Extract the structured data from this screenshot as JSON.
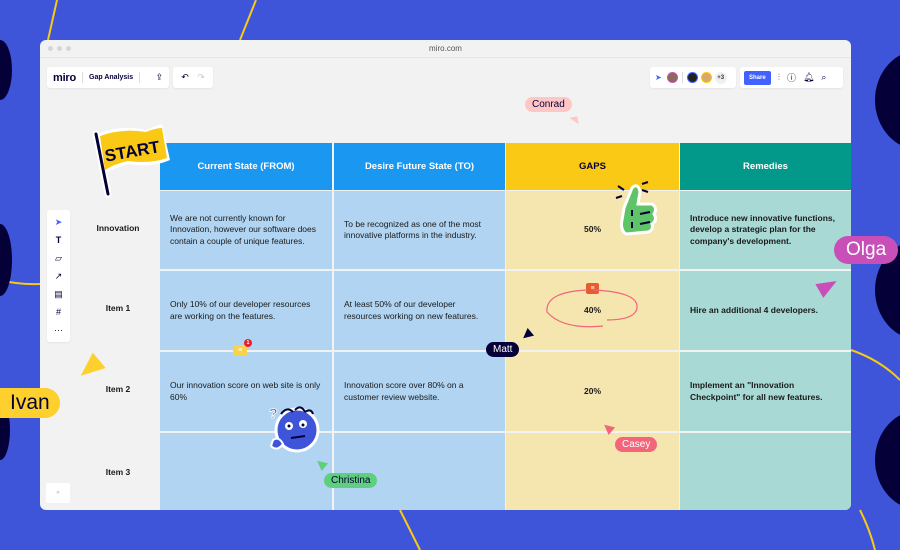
{
  "browser": {
    "url": "miro.com"
  },
  "header": {
    "logo": "miro",
    "board_name": "Gap Analysis",
    "upload_icon": "upload-icon",
    "undo_icon": "undo-icon",
    "redo_icon": "redo-icon",
    "collaborators_extra": "+3",
    "share_label": "Share",
    "icons": [
      "settings-sliders-icon",
      "help-icon",
      "bell-icon",
      "search-icon"
    ]
  },
  "toolbar": {
    "tools": [
      "select-icon",
      "text-icon",
      "sticky-note-icon",
      "line-arrow-icon",
      "comment-icon",
      "frame-icon",
      "more-icon"
    ],
    "expand_label": "»"
  },
  "colors": {
    "background": "#3e54d9",
    "from_header": "#1a97f0",
    "to_header": "#1a97f0",
    "gaps_header": "#f9c915",
    "remedies_header": "#02998a",
    "from_cell": "#b0d4f1",
    "gaps_cell": "#f5e6b0",
    "remedies_cell": "#a9d9d4"
  },
  "table": {
    "headers": [
      "Current State (FROM)",
      "Desire Future State (TO)",
      "GAPS",
      "Remedies"
    ],
    "rows": [
      {
        "label": "Innovation",
        "from": "We are not currently known for Innovation, however our software does contain a couple of unique features.",
        "to": "To be recognized as one of the most innovative platforms in the industry.",
        "gap": "50%",
        "remedy": "Introduce new innovative functions, develop a strategic plan for the company's development."
      },
      {
        "label": "Item 1",
        "from": "Only 10% of our developer resources are working on the features.",
        "to": "At least 50% of our developer resources working on new features.",
        "gap": "40%",
        "remedy": "Hire an additional 4 developers."
      },
      {
        "label": "Item 2",
        "from": "Our innovation score on web site is only 60%",
        "to": "Innovation score over 80% on a customer review website.",
        "gap": "20%",
        "remedy": "Implement an \"Innovation Checkpoint\" for all new features."
      },
      {
        "label": "Item 3",
        "from": "",
        "to": "",
        "gap": "",
        "remedy": ""
      }
    ]
  },
  "stickers": {
    "start_flag": "START",
    "comment_count": "1"
  },
  "cursors": [
    {
      "name": "Conrad",
      "color": "#ffc6c6",
      "text_color": "#050038"
    },
    {
      "name": "Olga",
      "color": "#c94fb8",
      "text_color": "#ffffff"
    },
    {
      "name": "Matt",
      "color": "#050038",
      "text_color": "#ffffff"
    },
    {
      "name": "Ivan",
      "color": "#fdd02e",
      "text_color": "#050038"
    },
    {
      "name": "Casey",
      "color": "#f2657a",
      "text_color": "#ffffff"
    },
    {
      "name": "Christina",
      "color": "#5fcf7d",
      "text_color": "#050038"
    }
  ]
}
